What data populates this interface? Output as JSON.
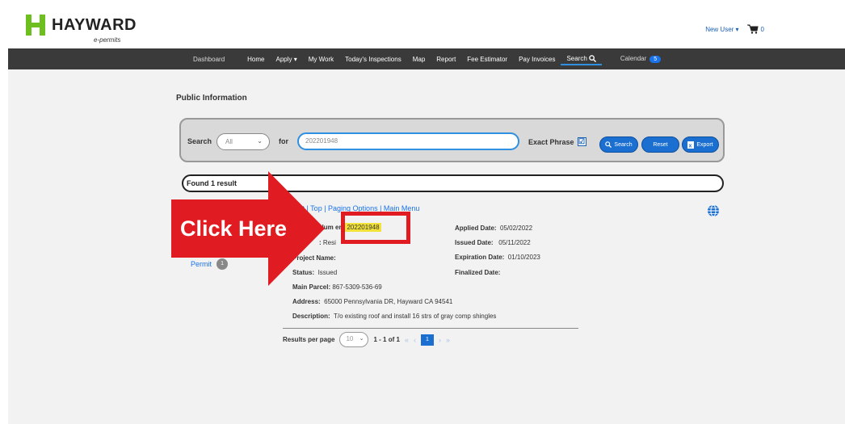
{
  "header": {
    "brand": "HAYWARD",
    "sub": "e-permits",
    "user": "New User ▾",
    "cart_count": "0"
  },
  "nav": {
    "items": [
      "Dashboard",
      "Home",
      "Apply ▾",
      "My Work",
      "Today's Inspections",
      "Map",
      "Report",
      "Fee Estimator",
      "Pay Invoices"
    ],
    "search": "Search",
    "calendar": "Calendar",
    "calendar_badge": "5"
  },
  "page_title": "Public Information",
  "search": {
    "label": "Search",
    "scope": "All",
    "for": "for",
    "query": "202201948",
    "exact_phrase": "Exact Phrase",
    "checkbox": "☑",
    "search_btn": "Search",
    "reset_btn": "Reset",
    "export_btn": "Export"
  },
  "result_summary": "Found 1 result",
  "links": "ext | Top | Paging Options | Main Menu",
  "sidebar": {
    "permit": "Permit",
    "permit_count": "1"
  },
  "record": {
    "number_label": "Num  er:",
    "number_value": "202201948",
    "type_label": ":",
    "type_value": "Resi",
    "project_label": "Project Name:",
    "status_label": "Status:",
    "status_value": "Issued",
    "parcel_label": "Main Parcel:",
    "parcel_value": "867-5309-536-69",
    "address_label": "Address:",
    "address_value": "65000 Pennsylvania DR, Hayward CA 94541",
    "desc_label": "Description:",
    "desc_value": "T/o existing roof and install 16 strs of gray comp shingles",
    "applied_label": "Applied Date:",
    "applied_value": "05/02/2022",
    "issued_label": "Issued Date:",
    "issued_value": "05/11/2022",
    "expiration_label": "Expiration Date:",
    "expiration_value": "01/10/2023",
    "finalized_label": "Finalized Date:"
  },
  "pager": {
    "rpp_label": "Results per page",
    "rpp_value": "10",
    "range": "1 - 1 of 1",
    "first": "«",
    "prev": "‹",
    "current": "1",
    "next": "›",
    "last": "»"
  },
  "annotation": {
    "text": "Click Here",
    "color": "#e11b22"
  }
}
